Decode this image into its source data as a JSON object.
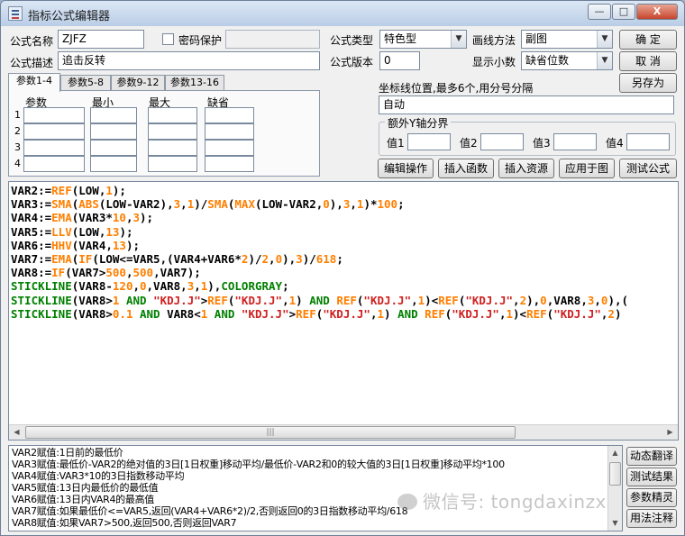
{
  "window": {
    "title": "指标公式编辑器"
  },
  "titlebar_buttons": {
    "minimize": "—",
    "maximize": "□",
    "close": "X"
  },
  "form": {
    "name_label": "公式名称",
    "name_value": "ZJFZ",
    "password_label": "密码保护",
    "password_checked": false,
    "desc_label": "公式描述",
    "desc_value": "追击反转",
    "type_label": "公式类型",
    "type_value": "特色型",
    "draw_label": "画线方法",
    "draw_value": "副图",
    "version_label": "公式版本",
    "version_value": "0",
    "decimals_label": "显示小数",
    "decimals_value": "缺省位数"
  },
  "buttons": {
    "confirm": "确  定",
    "cancel": "取  消",
    "save_as": "另存为",
    "edit_op": "编辑操作",
    "insert_func": "插入函数",
    "insert_res": "插入资源",
    "apply_chart": "应用于图",
    "test_formula": "测试公式"
  },
  "tabs": [
    "参数1-4",
    "参数5-8",
    "参数9-12",
    "参数13-16"
  ],
  "params": {
    "headers": [
      "参数",
      "最小",
      "最大",
      "缺省"
    ],
    "rows": [
      "1",
      "2",
      "3",
      "4"
    ]
  },
  "axis": {
    "label": "坐标线位置,最多6个,用分号分隔",
    "value": "自动",
    "group_label": "额外Y轴分界",
    "v1": "值1",
    "v2": "值2",
    "v3": "值3",
    "v4": "值4"
  },
  "code_lines": [
    [
      [
        "VAR2:=",
        "op"
      ],
      [
        "REF",
        "fn"
      ],
      [
        "(LOW,",
        "op"
      ],
      [
        "1",
        "num"
      ],
      [
        ");",
        "op"
      ]
    ],
    [
      [
        "VAR3:=",
        "op"
      ],
      [
        "SMA",
        "fn"
      ],
      [
        "(",
        "op"
      ],
      [
        "ABS",
        "fn"
      ],
      [
        "(LOW-VAR2),",
        "op"
      ],
      [
        "3",
        "num"
      ],
      [
        ",",
        "op"
      ],
      [
        "1",
        "num"
      ],
      [
        ")/",
        "op"
      ],
      [
        "SMA",
        "fn"
      ],
      [
        "(",
        "op"
      ],
      [
        "MAX",
        "fn"
      ],
      [
        "(LOW-VAR2,",
        "op"
      ],
      [
        "0",
        "num"
      ],
      [
        "),",
        "op"
      ],
      [
        "3",
        "num"
      ],
      [
        ",",
        "op"
      ],
      [
        "1",
        "num"
      ],
      [
        ")*",
        "op"
      ],
      [
        "100",
        "num"
      ],
      [
        ";",
        "op"
      ]
    ],
    [
      [
        "VAR4:=",
        "op"
      ],
      [
        "EMA",
        "fn"
      ],
      [
        "(VAR3*",
        "op"
      ],
      [
        "10",
        "num"
      ],
      [
        ",",
        "op"
      ],
      [
        "3",
        "num"
      ],
      [
        ");",
        "op"
      ]
    ],
    [
      [
        "VAR5:=",
        "op"
      ],
      [
        "LLV",
        "fn"
      ],
      [
        "(LOW,",
        "op"
      ],
      [
        "13",
        "num"
      ],
      [
        ");",
        "op"
      ]
    ],
    [
      [
        "VAR6:=",
        "op"
      ],
      [
        "HHV",
        "fn"
      ],
      [
        "(VAR4,",
        "op"
      ],
      [
        "13",
        "num"
      ],
      [
        ");",
        "op"
      ]
    ],
    [
      [
        "VAR7:=",
        "op"
      ],
      [
        "EMA",
        "fn"
      ],
      [
        "(",
        "op"
      ],
      [
        "IF",
        "fn"
      ],
      [
        "(LOW<=VAR5,(VAR4+VAR6*",
        "op"
      ],
      [
        "2",
        "num"
      ],
      [
        ")/",
        "op"
      ],
      [
        "2",
        "num"
      ],
      [
        ",",
        "op"
      ],
      [
        "0",
        "num"
      ],
      [
        "),",
        "op"
      ],
      [
        "3",
        "num"
      ],
      [
        ")/",
        "op"
      ],
      [
        "618",
        "num"
      ],
      [
        ";",
        "op"
      ]
    ],
    [
      [
        "VAR8:=",
        "op"
      ],
      [
        "IF",
        "fn"
      ],
      [
        "(VAR7>",
        "op"
      ],
      [
        "500",
        "num"
      ],
      [
        ",",
        "op"
      ],
      [
        "500",
        "num"
      ],
      [
        ",VAR7);",
        "op"
      ]
    ],
    [
      [
        "STICKLINE",
        "draw"
      ],
      [
        "(VAR8-",
        "op"
      ],
      [
        "120",
        "num"
      ],
      [
        ",",
        "op"
      ],
      [
        "0",
        "num"
      ],
      [
        ",VAR8,",
        "op"
      ],
      [
        "3",
        "num"
      ],
      [
        ",",
        "op"
      ],
      [
        "1",
        "num"
      ],
      [
        "),",
        "op"
      ],
      [
        "COLORGRAY",
        "draw"
      ],
      [
        ";",
        "op"
      ]
    ],
    [
      [
        "STICKLINE",
        "draw"
      ],
      [
        "(VAR8>",
        "op"
      ],
      [
        "1",
        "num"
      ],
      [
        " AND ",
        "draw"
      ],
      [
        "\"KDJ.J\"",
        "str"
      ],
      [
        ">",
        "op"
      ],
      [
        "REF",
        "fn"
      ],
      [
        "(",
        "op"
      ],
      [
        "\"KDJ.J\"",
        "str"
      ],
      [
        ",",
        "op"
      ],
      [
        "1",
        "num"
      ],
      [
        ") ",
        "op"
      ],
      [
        "AND ",
        "draw"
      ],
      [
        "REF",
        "fn"
      ],
      [
        "(",
        "op"
      ],
      [
        "\"KDJ.J\"",
        "str"
      ],
      [
        ",",
        "op"
      ],
      [
        "1",
        "num"
      ],
      [
        ")<",
        "op"
      ],
      [
        "REF",
        "fn"
      ],
      [
        "(",
        "op"
      ],
      [
        "\"KDJ.J\"",
        "str"
      ],
      [
        ",",
        "op"
      ],
      [
        "2",
        "num"
      ],
      [
        "),",
        "op"
      ],
      [
        "0",
        "num"
      ],
      [
        ",VAR8,",
        "op"
      ],
      [
        "3",
        "num"
      ],
      [
        ",",
        "op"
      ],
      [
        "0",
        "num"
      ],
      [
        "),(",
        "op"
      ]
    ],
    [
      [
        "STICKLINE",
        "draw"
      ],
      [
        "(VAR8>",
        "op"
      ],
      [
        "0.1",
        "num"
      ],
      [
        " AND ",
        "draw"
      ],
      [
        "VAR8<",
        "op"
      ],
      [
        "1",
        "num"
      ],
      [
        " AND ",
        "draw"
      ],
      [
        "\"KDJ.J\"",
        "str"
      ],
      [
        ">",
        "op"
      ],
      [
        "REF",
        "fn"
      ],
      [
        "(",
        "op"
      ],
      [
        "\"KDJ.J\"",
        "str"
      ],
      [
        ",",
        "op"
      ],
      [
        "1",
        "num"
      ],
      [
        ") ",
        "op"
      ],
      [
        "AND ",
        "draw"
      ],
      [
        "REF",
        "fn"
      ],
      [
        "(",
        "op"
      ],
      [
        "\"KDJ.J\"",
        "str"
      ],
      [
        ",",
        "op"
      ],
      [
        "1",
        "num"
      ],
      [
        ")<",
        "op"
      ],
      [
        "REF",
        "fn"
      ],
      [
        "(",
        "op"
      ],
      [
        "\"KDJ.J\"",
        "str"
      ],
      [
        ",",
        "op"
      ],
      [
        "2",
        "num"
      ],
      [
        ")",
        "op"
      ]
    ]
  ],
  "output_lines": [
    "VAR2赋值:1日前的最低价",
    "VAR3赋值:最低价-VAR2的绝对值的3日[1日权重]移动平均/最低价-VAR2和0的较大值的3日[1日权重]移动平均*100",
    "VAR4赋值:VAR3*10的3日指数移动平均",
    "VAR5赋值:13日内最低价的最低值",
    "VAR6赋值:13日内VAR4的最高值",
    "VAR7赋值:如果最低价<=VAR5,返回(VAR4+VAR6*2)/2,否则返回0的3日指数移动平均/618",
    "VAR8赋值:如果VAR7>500,返回500,否则返回VAR7"
  ],
  "side_buttons": [
    "动态翻译",
    "测试结果",
    "参数精灵",
    "用法注释"
  ],
  "watermark": "微信号: tongdaxinzx",
  "colors": {
    "function": "#ff7f00",
    "drawing": "#008000",
    "string": "#d02020",
    "number": "#ff7f00"
  }
}
